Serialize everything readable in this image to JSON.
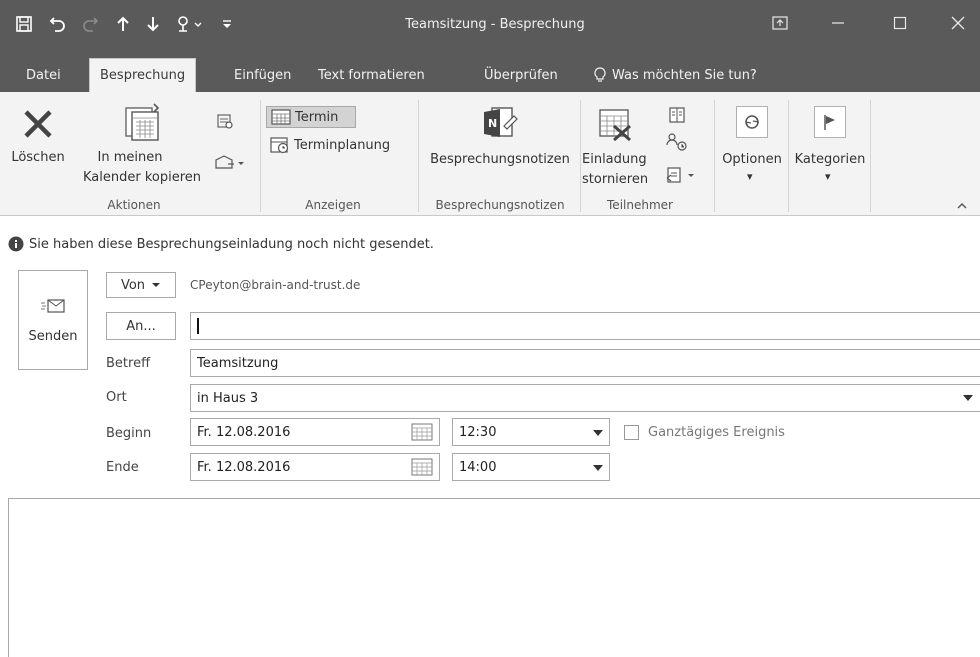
{
  "window": {
    "title": "Teamsitzung - Besprechung"
  },
  "tabs": [
    {
      "label": "Datei"
    },
    {
      "label": "Besprechung"
    },
    {
      "label": "Einfügen"
    },
    {
      "label": "Text formatieren"
    },
    {
      "label": "Überprüfen"
    },
    {
      "label": "Was möchten Sie tun?"
    }
  ],
  "ribbon": {
    "loeschen": "Löschen",
    "in_meinen": "In meinen",
    "kalender_kopieren": "Kalender kopieren",
    "aktionen": "Aktionen",
    "termin": "Termin",
    "terminplanung": "Terminplanung",
    "anzeigen": "Anzeigen",
    "besprechungsnotizen_btn": "Besprechungsnotizen",
    "besprechungsnotizen_group": "Besprechungsnotizen",
    "einladung": "Einladung",
    "stornieren": "stornieren",
    "teilnehmer": "Teilnehmer",
    "optionen": "Optionen",
    "kategorien": "Kategorien"
  },
  "info_bar": {
    "text": "Sie haben diese Besprechungseinladung noch nicht gesendet."
  },
  "form": {
    "send_label": "Senden",
    "von_label": "Von",
    "von_value": "CPeyton@brain-and-trust.de",
    "an_label": "An...",
    "an_value": "",
    "betreff_label": "Betreff",
    "betreff_value": "Teamsitzung",
    "ort_label": "Ort",
    "ort_value": "in Haus 3",
    "beginn_label": "Beginn",
    "beginn_date": "Fr. 12.08.2016",
    "beginn_time": "12:30",
    "ganztaegig_label": "Ganztägiges Ereignis",
    "ende_label": "Ende",
    "ende_date": "Fr. 12.08.2016",
    "ende_time": "14:00"
  },
  "body": {
    "text": ""
  }
}
